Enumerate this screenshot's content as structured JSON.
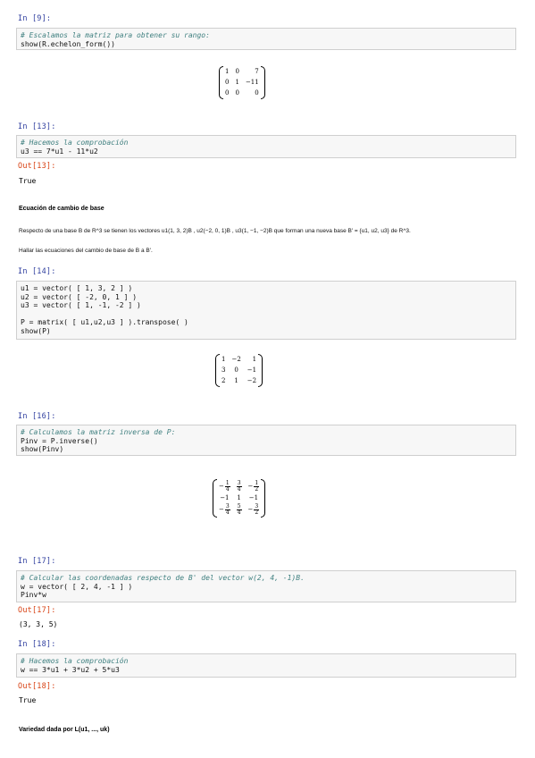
{
  "cells": [
    {
      "in_prompt": "In [9]:",
      "code": [
        {
          "type": "comment",
          "text": "# Escalamos la matriz para obtener su rango:"
        },
        {
          "type": "code",
          "text": "show(R.echelon_form())"
        }
      ],
      "output_matrix": [
        [
          "1",
          "0",
          "7"
        ],
        [
          "0",
          "1",
          "−11"
        ],
        [
          "0",
          "0",
          "0"
        ]
      ]
    },
    {
      "in_prompt": "In [13]:",
      "code": [
        {
          "type": "comment",
          "text": "# Hacemos la comprobación"
        },
        {
          "type": "code",
          "text": "u3 == 7*u1 - 11*u2"
        }
      ],
      "out_prompt": "Out[13]:",
      "output_text": "True"
    },
    {
      "in_prompt": "In [14]:",
      "code": [
        {
          "type": "code",
          "text": "u1 = vector( [ 1, 3, 2 ] )"
        },
        {
          "type": "code",
          "text": "u2 = vector( [ -2, 0, 1 ] )"
        },
        {
          "type": "code",
          "text": "u3 = vector( [ 1, -1, -2 ] )"
        },
        {
          "type": "code",
          "text": ""
        },
        {
          "type": "code",
          "text": "P = matrix( [ u1,u2,u3 ] ).transpose( )"
        },
        {
          "type": "code",
          "text": "show(P)"
        }
      ],
      "output_matrix": [
        [
          "1",
          "−2",
          "1"
        ],
        [
          "3",
          "0",
          "−1"
        ],
        [
          "2",
          "1",
          "−2"
        ]
      ]
    },
    {
      "in_prompt": "In [16]:",
      "code": [
        {
          "type": "comment",
          "text": "# Calculamos la matriz inversa de P:"
        },
        {
          "type": "code",
          "text": "Pinv = P.inverse()"
        },
        {
          "type": "code",
          "text": "show(Pinv)"
        }
      ]
    },
    {
      "in_prompt": "In [17]:",
      "code": [
        {
          "type": "comment",
          "text": "# Calcular las coordenadas respecto de B' del vector w(2, 4, -1)B."
        },
        {
          "type": "code",
          "text": "w = vector( [ 2, 4, -1 ] )"
        },
        {
          "type": "code",
          "text": "Pinv*w"
        }
      ],
      "out_prompt": "Out[17]:",
      "output_text": "(3, 3, 5)"
    },
    {
      "in_prompt": "In [18]:",
      "code": [
        {
          "type": "comment",
          "text": "# Hacemos la comprobación"
        },
        {
          "type": "code",
          "text": "w == 3*u1 + 3*u2 + 5*u3"
        }
      ],
      "out_prompt": "Out[18]:",
      "output_text": "True"
    }
  ],
  "inverse_matrix": {
    "r1": {
      "c1_sign": "−",
      "c1_num": "1",
      "c1_den": "4",
      "c2_num": "3",
      "c2_den": "4",
      "c3_sign": "−",
      "c3_num": "1",
      "c3_den": "2"
    },
    "r2": {
      "c1": "−1",
      "c2": "1",
      "c3": "−1"
    },
    "r3": {
      "c1_sign": "−",
      "c1_num": "3",
      "c1_den": "4",
      "c2_num": "5",
      "c2_den": "4",
      "c3_sign": "−",
      "c3_num": "3",
      "c3_den": "2"
    }
  },
  "markdown": {
    "heading1": "Ecuación de cambio de base",
    "para1": "Respecto de una base B de R^3 se tienen los vectores u1(1, 3, 2)B , u2(−2, 0, 1)B , u3(1, −1, −2)B que forman una nueva base B' = {u1, u2, u3} de R^3.",
    "para2": "Hallar las ecuaciones del cambio de base de B a B'.",
    "heading2": "Variedad dada por L(u1, ..., uk)"
  }
}
